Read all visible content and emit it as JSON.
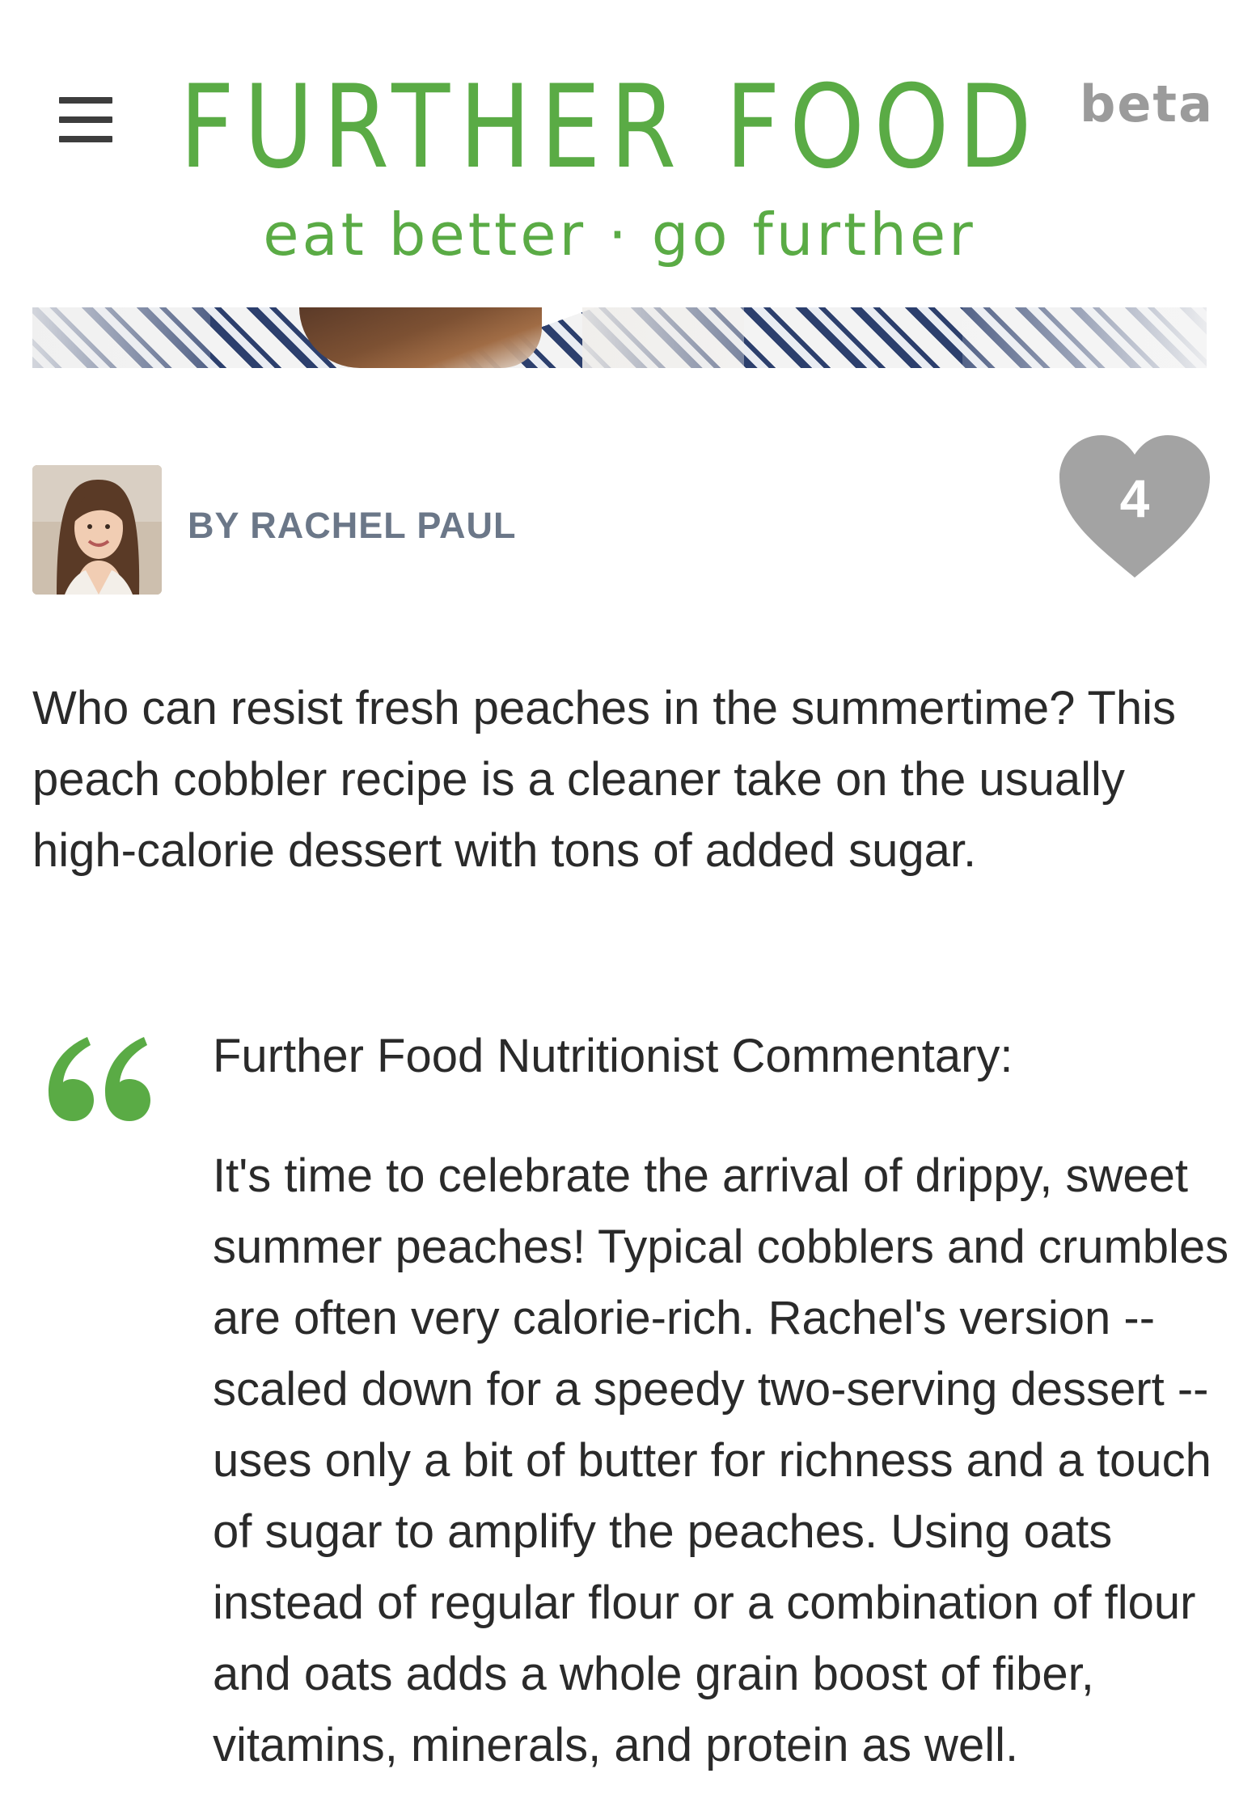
{
  "header": {
    "brand": "FURTHER FOOD",
    "beta": "beta",
    "tagline": "eat better · go further",
    "brand_color": "#5aab45"
  },
  "menu": {
    "icon": "hamburger-menu-icon"
  },
  "article": {
    "author": "BY RACHEL PAUL",
    "likes": "4",
    "intro": "Who can resist fresh peaches in the summertime? This peach cobbler recipe is a cleaner take on the usually high-calorie dessert with tons of added sugar.",
    "commentary_title": "Further Food Nutritionist Commentary:",
    "commentary_body": "It's time to celebrate the arrival of drippy, sweet summer peaches! Typical cobblers and crumbles are often very calorie-rich. Rachel's version -- scaled down for a speedy two-serving dessert -- uses only a bit of butter for richness and a touch of sugar to amplify the peaches. Using oats instead of regular flour or a combination of flour and oats adds a whole grain boost of fiber, vitamins, minerals, and protein as well."
  }
}
